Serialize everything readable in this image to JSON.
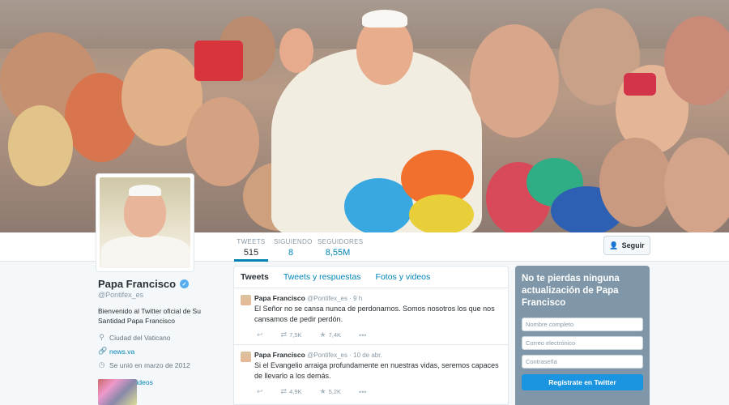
{
  "nav": {
    "stats": [
      {
        "label": "TWEETS",
        "value": "515"
      },
      {
        "label": "SIGUIENDO",
        "value": "8"
      },
      {
        "label": "SEGUIDORES",
        "value": "8,55M"
      }
    ],
    "follow_label": "Seguir"
  },
  "profile": {
    "name": "Papa Francisco",
    "handle": "@Pontifex_es",
    "bio": "Bienvenido al Twitter oficial de Su Santidad Papa Francisco",
    "location": "Ciudad del Vaticano",
    "website": "news.va",
    "joined": "Se unió en marzo de 2012",
    "photos_label": "Fotos y videos"
  },
  "timeline": {
    "tabs": [
      "Tweets",
      "Tweets y respuestas",
      "Fotos y videos"
    ],
    "tweets": [
      {
        "name": "Papa Francisco",
        "handle": "@Pontifex_es · 9 h",
        "text": "El Señor no se cansa nunca de perdonarnos. Somos nosotros los que nos cansamos de pedir perdón.",
        "retweets": "7,5K",
        "favorites": "7,4K"
      },
      {
        "name": "Papa Francisco",
        "handle": "@Pontifex_es · 10 de abr.",
        "text": "Si el Evangelio arraiga profundamente en nuestras vidas, seremos capaces de llevarlo a los demás.",
        "retweets": "4,9K",
        "favorites": "5,2K"
      }
    ]
  },
  "signup": {
    "title": "No te pierdas ninguna actualización de Papa Francisco",
    "name_placeholder": "Nombre completo",
    "email_placeholder": "Correo electrónico",
    "password_placeholder": "Contraseña",
    "button_label": "Regístrate en Twitter"
  },
  "colors": {
    "link": "#0084b4",
    "signup_bg": "#7f97a8",
    "button_blue": "#1b95e0"
  }
}
